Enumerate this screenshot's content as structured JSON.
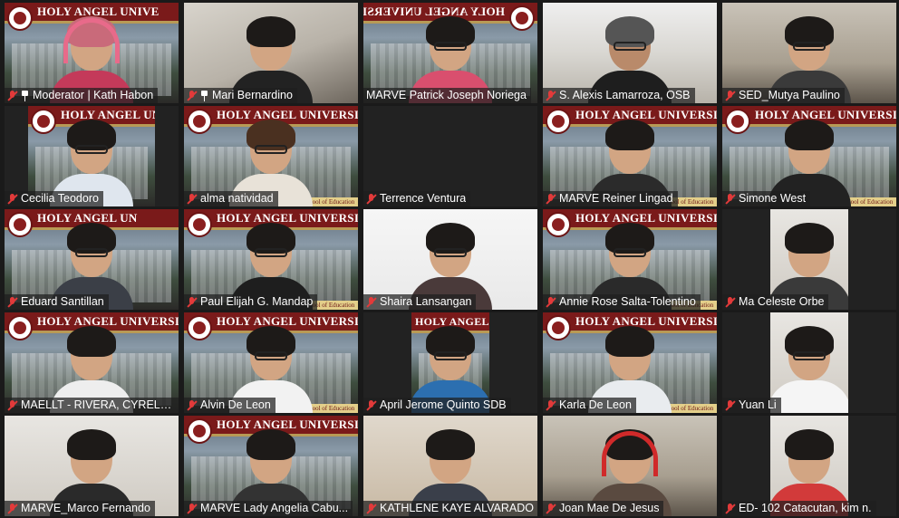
{
  "meeting": {
    "participants": [
      {
        "name": "Moderator | Kath Habon",
        "banner": "HOLY ANGEL UNIVE",
        "pinned": true,
        "muted": true
      },
      {
        "name": "Mari Bernardino",
        "banner": "",
        "pinned": true,
        "muted": true
      },
      {
        "name": "MARVE Patrick Joseph Noriega",
        "banner": "HOLY ANGEL UNIVERSITY",
        "active_speaker": true,
        "muted": false
      },
      {
        "name": "S. Alexis Lamarroza, OSB",
        "banner": "",
        "muted": true
      },
      {
        "name": "SED_Mutya Paulino",
        "banner": "",
        "muted": true
      },
      {
        "name": "Cecilia Teodoro",
        "banner": "HOLY ANGEL UNIVERSITY",
        "muted": true
      },
      {
        "name": "alma natividad",
        "banner": "HOLY ANGEL UNIVERSITY",
        "muted": true
      },
      {
        "name": "Terrence Ventura",
        "banner": "",
        "muted": true
      },
      {
        "name": "MARVE Reiner Lingad",
        "banner": "HOLY ANGEL UNIVERSITY",
        "muted": true
      },
      {
        "name": "Simone West",
        "banner": "HOLY ANGEL UNIVERSITY",
        "muted": true
      },
      {
        "name": "Eduard Santillan",
        "banner": "HOLY ANGEL UN",
        "muted": true
      },
      {
        "name": "Paul Elijah G. Mandap",
        "banner": "HOLY ANGEL UNIVERSITY",
        "muted": true
      },
      {
        "name": "Shaira Lansangan",
        "banner": "",
        "muted": true
      },
      {
        "name": "Annie Rose Salta-Tolentino",
        "banner": "HOLY ANGEL UNIVERSITY",
        "muted": true
      },
      {
        "name": "Ma Celeste Orbe",
        "banner": "",
        "muted": true
      },
      {
        "name": "MAELLT - RIVERA, CYRELLE...",
        "banner": "HOLY ANGEL UNIVERSITY",
        "muted": true
      },
      {
        "name": "Alvin De Leon",
        "banner": "HOLY ANGEL UNIVERSITY",
        "muted": true
      },
      {
        "name": "April Jerome Quinto SDB",
        "banner": "HOLY ANGEL UNI",
        "muted": true
      },
      {
        "name": "Karla De Leon",
        "banner": "HOLY ANGEL UNIVERSITY",
        "muted": true
      },
      {
        "name": "Yuan Li",
        "banner": "",
        "muted": true
      },
      {
        "name": "MARVE_Marco Fernando",
        "banner": "",
        "muted": true
      },
      {
        "name": "MARVE Lady Angelia Cabu...",
        "banner": "HOLY ANGEL UNIVERSITY",
        "muted": true
      },
      {
        "name": "KATHLENE KAYE ALVARADO",
        "banner": "",
        "muted": true
      },
      {
        "name": "Joan Mae De Jesus",
        "banner": "",
        "muted": true
      },
      {
        "name": "ED- 102 Catacutan, kim n.",
        "banner": "",
        "muted": true
      }
    ],
    "school_footer": "Graduate School of Education",
    "accent": "#e6e030",
    "muted_icon_color": "#e23a3a",
    "icons": {
      "muted": "mic-muted-icon",
      "pinned": "pin-icon",
      "seal": "university-seal-icon"
    }
  }
}
